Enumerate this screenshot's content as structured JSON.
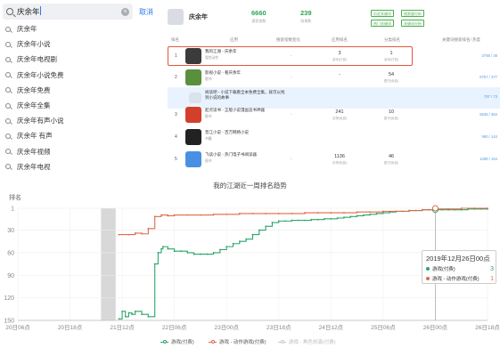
{
  "search": {
    "query": "庆余年",
    "clear_icon": "×",
    "cancel_label": "取消",
    "suggestions": [
      "庆余年",
      "庆余年小说",
      "庆余年电视剧",
      "庆余年小说免费",
      "庆余年免费",
      "庆余年全集",
      "庆余年有声小说",
      "庆余年 有声",
      "庆余年视频",
      "庆余年电视"
    ]
  },
  "rank": {
    "app_name": "庆余年",
    "stats": [
      {
        "num": "6660",
        "label": "搜索指数"
      },
      {
        "num": "239",
        "label": "结果数"
      }
    ],
    "tags": [
      "历史关键词",
      "搜索量分析",
      "热门关键词",
      "关键词分析"
    ],
    "columns": [
      "排名",
      "应用",
      "搜索指数变化",
      "应用排名",
      "分类排名",
      "关键词搜索排名/ 热度"
    ],
    "rows": [
      {
        "idx": "1",
        "name": "我的江湖 - 庆余年",
        "sub": "冒险动作",
        "v1": "-",
        "v2": "3",
        "v2s": "游戏(付费)",
        "v3": "1",
        "v3s": "游戏(付费)",
        "v4": "3756 / 38",
        "highlight": false,
        "icon_color": "#3b3b3b"
      },
      {
        "idx": "2",
        "name": "影视小说 - 看庆余年",
        "sub": "图书",
        "v1": "-",
        "v2": "-",
        "v2s": "",
        "v3": "54",
        "v3s": "图书(免费)",
        "v4": "6757 / 377",
        "highlight": false,
        "icon_color": "#5a8f3e"
      },
      {
        "idx": "",
        "name": "阅读吧 - 小说下载看全本免费全集，就可以找到小说的故事",
        "sub": "",
        "v1": "",
        "v2": "",
        "v2s": "",
        "v3": "",
        "v3s": "",
        "v4": "797 / 73",
        "highlight": true,
        "icon_color": "#d9e3ec"
      },
      {
        "idx": "3",
        "name": "起点读书 - 正版小说漫画追书神器",
        "sub": "图书",
        "v1": "-",
        "v2": "241",
        "v2s": "总榜(免费)",
        "v3": "10",
        "v3s": "图书(免费)",
        "v4": "5535 / 364",
        "highlight": false,
        "icon_color": "#d2402a"
      },
      {
        "idx": "4",
        "name": "晋江小说 - 百万网络小说",
        "sub": "书籍",
        "v1": "",
        "v2": "",
        "v2s": "",
        "v3": "",
        "v3s": "",
        "v4": "990 / 144",
        "highlight": false,
        "icon_color": "#222222"
      },
      {
        "idx": "5",
        "name": "飞读小说 - 热门电子书阅读器",
        "sub": "图书",
        "v1": "-",
        "v2": "1136",
        "v2s": "总榜(免费)",
        "v3": "46",
        "v3s": "图书(免费)",
        "v4": "1298 / 154",
        "highlight": false,
        "icon_color": "#4a90e2"
      }
    ]
  },
  "chart": {
    "title": "我的江湖近一周排名趋势",
    "ylabel": "排名",
    "tooltip": {
      "title": "2019年12月26日00点",
      "rows": [
        {
          "name": "游戏(付费)",
          "value": "3",
          "color": "#2ea56b"
        },
        {
          "name": "游戏 - 动作游戏(付费)",
          "value": "1",
          "color": "#e06a4a"
        }
      ]
    },
    "legend": [
      "游戏(付费)",
      "游戏 - 动作游戏(付费)",
      "游戏 - 角色扮演(付费)"
    ]
  },
  "chart_data": {
    "type": "line",
    "title": "我的江湖近一周排名趋势",
    "ylabel": "排名",
    "xlabel": "",
    "y_inverted": true,
    "ylim": [
      1,
      150
    ],
    "yticks": [
      1,
      30,
      60,
      90,
      120,
      150
    ],
    "xticks": [
      "20日06点",
      "20日18点",
      "21日12点",
      "22日06点",
      "23日00点",
      "23日18点",
      "24日12点",
      "25日06点",
      "26日00点",
      "26日18点"
    ],
    "x_range_hours": [
      0,
      144
    ],
    "shaded_range_hours": [
      25.5,
      30
    ],
    "series": [
      {
        "name": "游戏(付费)",
        "color": "#2ea56b",
        "x_hours": [
          31,
          32,
          33,
          34,
          35,
          36,
          38,
          40,
          42,
          43,
          44,
          44.5,
          46,
          48,
          50,
          52,
          54,
          56,
          58,
          60,
          62,
          64,
          66,
          68,
          70,
          72,
          74,
          76,
          78,
          80,
          82,
          84,
          86,
          88,
          90,
          92,
          94,
          96,
          98,
          100,
          102,
          104,
          106,
          108,
          110,
          112,
          114,
          116,
          118,
          120,
          122,
          124,
          126,
          128,
          130,
          132,
          134,
          136,
          138,
          140,
          142,
          144
        ],
        "values": [
          148,
          138,
          145,
          140,
          142,
          138,
          142,
          145,
          75,
          60,
          55,
          52,
          55,
          58,
          58,
          60,
          62,
          62,
          62,
          60,
          56,
          52,
          48,
          45,
          42,
          36,
          30,
          25,
          20,
          18,
          18,
          17,
          17,
          17,
          16,
          16,
          15,
          15,
          14,
          13,
          12,
          11,
          10,
          9,
          8,
          7,
          6,
          5,
          5,
          4,
          4,
          3,
          3,
          3,
          3,
          3,
          3,
          3,
          2,
          2,
          2,
          2
        ]
      },
      {
        "name": "游戏 - 动作游戏(付费)",
        "color": "#e06a4a",
        "x_hours": [
          31,
          34,
          36,
          38,
          40,
          42,
          44,
          46,
          48,
          52,
          56,
          60,
          64,
          68,
          72,
          76,
          80,
          84,
          88,
          92,
          96,
          100,
          104,
          108,
          112,
          116,
          120,
          124,
          128,
          132,
          136,
          140,
          144
        ],
        "values": [
          36,
          36,
          34,
          35,
          28,
          12,
          10,
          11,
          10,
          10,
          10,
          9,
          9,
          8,
          8,
          8,
          8,
          8,
          7,
          7,
          7,
          7,
          6,
          6,
          5,
          5,
          4,
          3,
          2,
          2,
          1,
          1,
          1
        ]
      },
      {
        "name": "游戏 - 角色扮演(付费)",
        "color": "#c8c8c8",
        "x_hours": [],
        "values": []
      }
    ],
    "grid": true,
    "legend_position": "bottom"
  }
}
